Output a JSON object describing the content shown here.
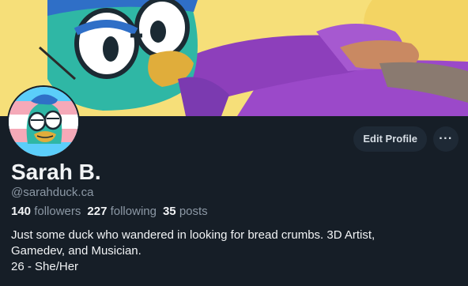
{
  "profile": {
    "name": "Sarah B.",
    "handle": "@sarahduck.ca",
    "stats": {
      "followers_count": "140",
      "followers_label": "followers",
      "following_count": "227",
      "following_label": "following",
      "posts_count": "35",
      "posts_label": "posts"
    },
    "bio_lines": [
      "Just some duck who wandered in looking for bread crumbs. 3D Artist,",
      "Gamedev, and Musician.",
      "26 - She/Her"
    ]
  },
  "actions": {
    "edit_label": "Edit Profile",
    "more_label": "···"
  },
  "icons": {
    "more": "more-horizontal-icon"
  },
  "colors": {
    "background": "#161e27",
    "button_bg": "#1e2935",
    "muted_text": "#8c98a5",
    "banner_yellow": "#f6df79",
    "duck_teal": "#2fb7a5",
    "hoodie_purple": "#9b49c9"
  }
}
